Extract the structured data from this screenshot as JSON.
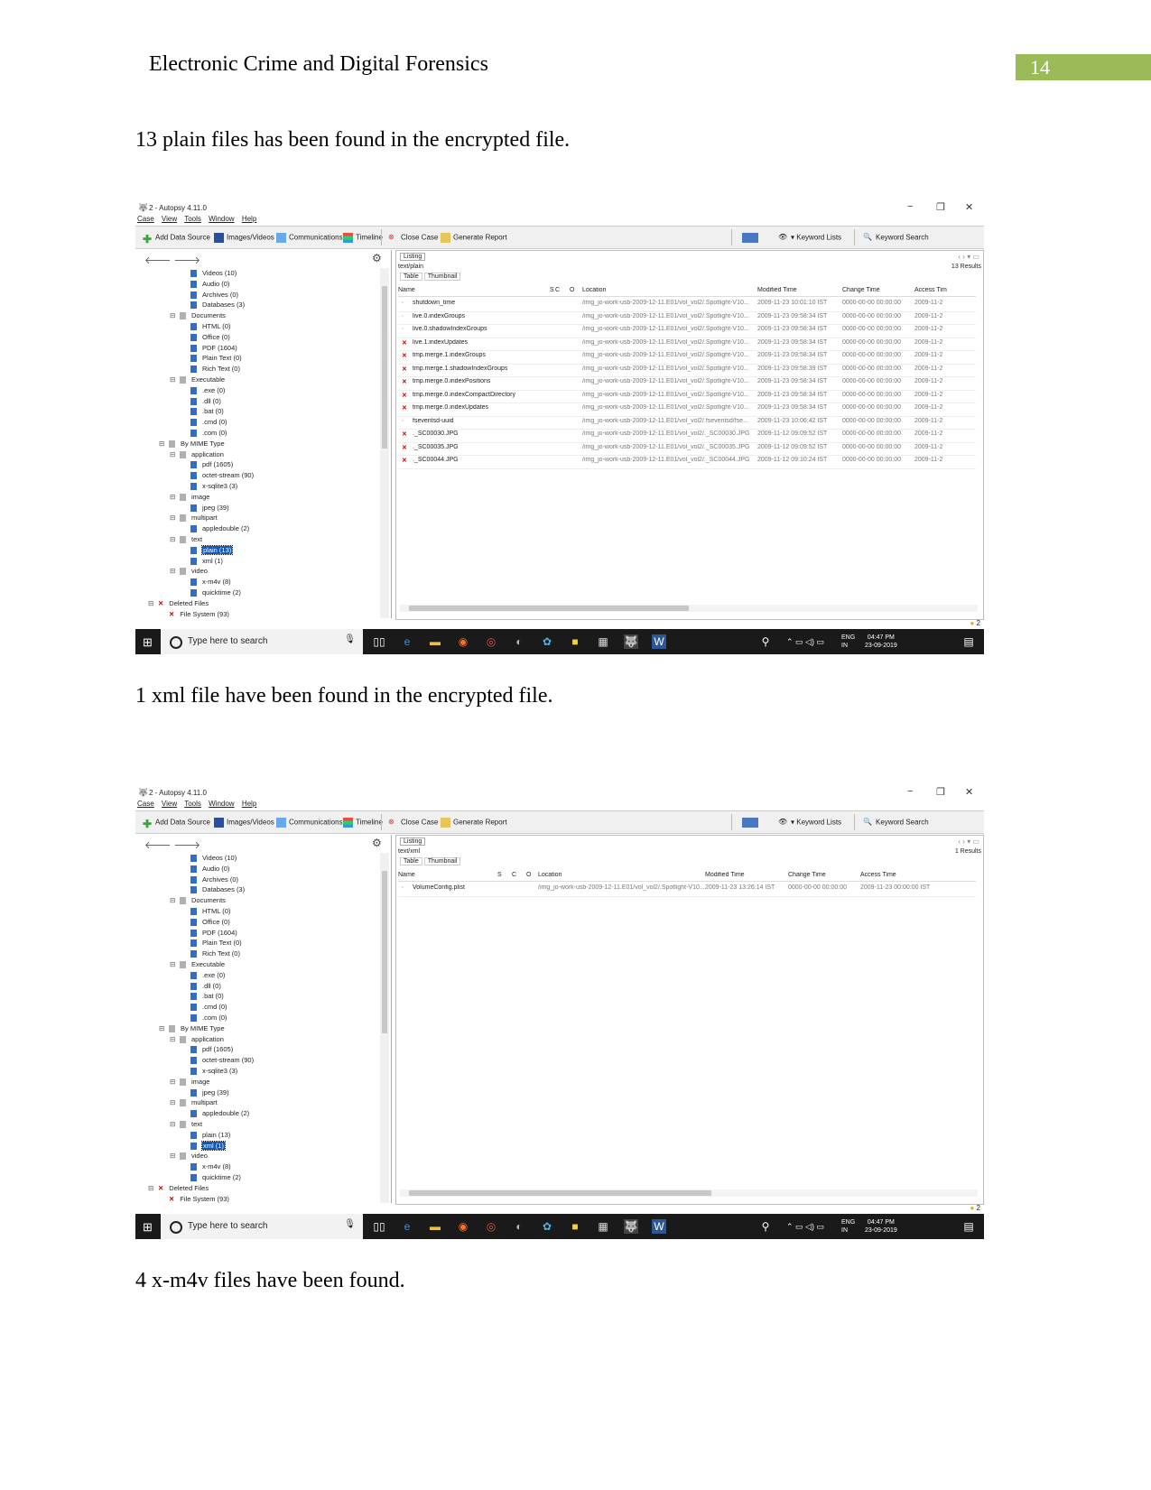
{
  "header": {
    "running_head": "Electronic Crime and Digital Forensics",
    "page_number": "14"
  },
  "paragraphs": [
    "13 plain files has been found in the encrypted file.",
    "1 xml file have been found in the encrypted file.",
    "4 x-m4v files have been found."
  ],
  "app": {
    "window_title": "2 - Autopsy 4.11.0",
    "menu": [
      "Case",
      "View",
      "Tools",
      "Window",
      "Help"
    ],
    "toolbar": {
      "add_data_source": "Add Data Source",
      "images_videos": "Images/Videos",
      "communications": "Communications",
      "timeline": "Timeline",
      "close_case": "Close Case",
      "generate_report": "Generate Report",
      "keyword_lists": "Keyword Lists",
      "keyword_search": "Keyword Search"
    },
    "tree": [
      "Videos (10)",
      "Audio (0)",
      "Archives (0)",
      "Databases (3)",
      "Documents",
      "HTML (0)",
      "Office (0)",
      "PDF (1604)",
      "Plain Text (0)",
      "Rich Text (0)",
      "Executable",
      ".exe (0)",
      ".dll (0)",
      ".bat (0)",
      ".cmd (0)",
      ".com (0)",
      "By MIME Type",
      "application",
      "pdf (1605)",
      "octet-stream (90)",
      "x-sqlite3 (3)",
      "image",
      "jpeg (39)",
      "multipart",
      "appledouble (2)",
      "text",
      "plain (13)",
      "xml (1)",
      "video",
      "x-m4v (8)",
      "quicktime (2)",
      "Deleted Files",
      "File System (93)"
    ],
    "listing_tab": "Listing",
    "subtabs": [
      "Table",
      "Thumbnail"
    ],
    "status_badge": "2",
    "taskbar": {
      "search_placeholder": "Type here to search",
      "lang": "ENG",
      "region": "IN",
      "time": "04:47 PM",
      "date": "23-09-2019",
      "notif": "2"
    }
  },
  "screenshots": [
    {
      "path": "text/plain",
      "results": "13 Results",
      "selected": "plain (13)",
      "columns": [
        "Name",
        "S",
        "C",
        "O",
        "Location",
        "Modified Time",
        "Change Time",
        "Access Tim"
      ],
      "rows": [
        {
          "name": "shutdown_time",
          "deleted": false,
          "location": "/img_jo-work-usb-2009-12-11.E01/vol_vol2/.Spotlight-V10...",
          "modified": "2009-11-23 10:01:10 IST",
          "change": "0000-00-00 00:00:00",
          "access": "2009-11-2"
        },
        {
          "name": "live.0.indexGroups",
          "deleted": false,
          "location": "/img_jo-work-usb-2009-12-11.E01/vol_vol2/.Spotlight-V10...",
          "modified": "2009-11-23 09:58:34 IST",
          "change": "0000-00-00 00:00:00",
          "access": "2009-11-2"
        },
        {
          "name": "live.0.shadowIndexGroups",
          "deleted": false,
          "location": "/img_jo-work-usb-2009-12-11.E01/vol_vol2/.Spotlight-V10...",
          "modified": "2009-11-23 09:58:34 IST",
          "change": "0000-00-00 00:00:00",
          "access": "2009-11-2"
        },
        {
          "name": "live.1.indexUpdates",
          "deleted": true,
          "location": "/img_jo-work-usb-2009-12-11.E01/vol_vol2/.Spotlight-V10...",
          "modified": "2009-11-23 09:58:34 IST",
          "change": "0000-00-00 00:00:00",
          "access": "2009-11-2"
        },
        {
          "name": "tmp.merge.1.indexGroups",
          "deleted": true,
          "location": "/img_jo-work-usb-2009-12-11.E01/vol_vol2/.Spotlight-V10...",
          "modified": "2009-11-23 09:58:34 IST",
          "change": "0000-00-00 00:00:00",
          "access": "2009-11-2"
        },
        {
          "name": "tmp.merge.1.shadowIndexGroups",
          "deleted": true,
          "location": "/img_jo-work-usb-2009-12-11.E01/vol_vol2/.Spotlight-V10...",
          "modified": "2009-11-23 09:58:39 IST",
          "change": "0000-00-00 00:00:00",
          "access": "2009-11-2"
        },
        {
          "name": "tmp.merge.0.indexPositions",
          "deleted": true,
          "location": "/img_jo-work-usb-2009-12-11.E01/vol_vol2/.Spotlight-V10...",
          "modified": "2009-11-23 09:58:34 IST",
          "change": "0000-00-00 00:00:00",
          "access": "2009-11-2"
        },
        {
          "name": "tmp.merge.0.indexCompactDirectory",
          "deleted": true,
          "location": "/img_jo-work-usb-2009-12-11.E01/vol_vol2/.Spotlight-V10...",
          "modified": "2009-11-23 09:58:34 IST",
          "change": "0000-00-00 00:00:00",
          "access": "2009-11-2"
        },
        {
          "name": "tmp.merge.0.indexUpdates",
          "deleted": true,
          "location": "/img_jo-work-usb-2009-12-11.E01/vol_vol2/.Spotlight-V10...",
          "modified": "2009-11-23 09:58:34 IST",
          "change": "0000-00-00 00:00:00",
          "access": "2009-11-2"
        },
        {
          "name": "fseventsd-uuid",
          "deleted": false,
          "location": "/img_jo-work-usb-2009-12-11.E01/vol_vol2/.fseventsd/fse...",
          "modified": "2009-11-23 10:06:42 IST",
          "change": "0000-00-00 00:00:00",
          "access": "2009-11-2"
        },
        {
          "name": "._SC00030.JPG",
          "deleted": true,
          "location": "/img_jo-work-usb-2009-12-11.E01/vol_vol2/._SC00030.JPG",
          "modified": "2009-11-12 09:09:52 IST",
          "change": "0000-00-00 00:00:00",
          "access": "2009-11-2"
        },
        {
          "name": "._SC00035.JPG",
          "deleted": true,
          "location": "/img_jo-work-usb-2009-12-11.E01/vol_vol2/._SC00035.JPG",
          "modified": "2009-11-12 09:09:52 IST",
          "change": "0000-00-00 00:00:00",
          "access": "2009-11-2"
        },
        {
          "name": "._SC00044.JPG",
          "deleted": true,
          "location": "/img_jo-work-usb-2009-12-11.E01/vol_vol2/._SC00044.JPG",
          "modified": "2009-11-12 09:10:24 IST",
          "change": "0000-00-00 00:00:00",
          "access": "2009-11-2"
        }
      ]
    },
    {
      "path": "text/xml",
      "results": "1 Results",
      "selected": "xml (1)",
      "columns": [
        "Name",
        "S",
        "C",
        "O",
        "Location",
        "Modified Time",
        "Change Time",
        "Access Time"
      ],
      "rows": [
        {
          "name": "VolumeConfig.plist",
          "deleted": false,
          "location": "/img_jo-work-usb-2009-12-11.E01/vol_vol2/.Spotlight-V10...",
          "modified": "2009-11-23 13:26:14 IST",
          "change": "0000-00-00 00:00:00",
          "access": "2009-11-23 00:00:00 IST"
        }
      ]
    }
  ]
}
